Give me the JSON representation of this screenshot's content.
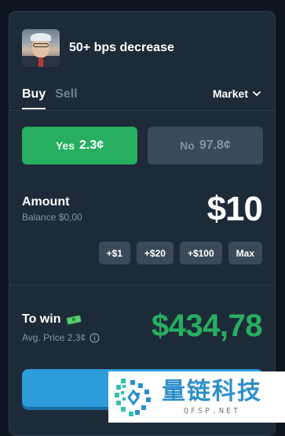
{
  "market": {
    "title": "50+ bps decrease",
    "avatar_icon": "person-portrait-icon"
  },
  "tabs": [
    {
      "label": "Buy",
      "active": true
    },
    {
      "label": "Sell",
      "active": false
    }
  ],
  "order_type": {
    "label": "Market",
    "icon": "chevron-down-icon"
  },
  "outcomes": {
    "yes": {
      "label": "Yes",
      "price": "2.3¢",
      "color": "#27ae60"
    },
    "no": {
      "label": "No",
      "price": "97.8¢",
      "color": "#3a4a5b"
    }
  },
  "amount": {
    "label": "Amount",
    "balance": "Balance $0,00",
    "value": "$10"
  },
  "quick_add": [
    "+$1",
    "+$20",
    "+$100",
    "Max"
  ],
  "to_win": {
    "label": "To win",
    "icon": "money-icon",
    "avg_price": "Avg. Price 2,3¢",
    "info_icon": "info-icon",
    "value": "$434,78",
    "color": "#27ae60"
  },
  "trade_button": {
    "color": "#2d9cdb"
  },
  "watermark": {
    "text": "量链科技",
    "url": "QFSP.NET"
  }
}
